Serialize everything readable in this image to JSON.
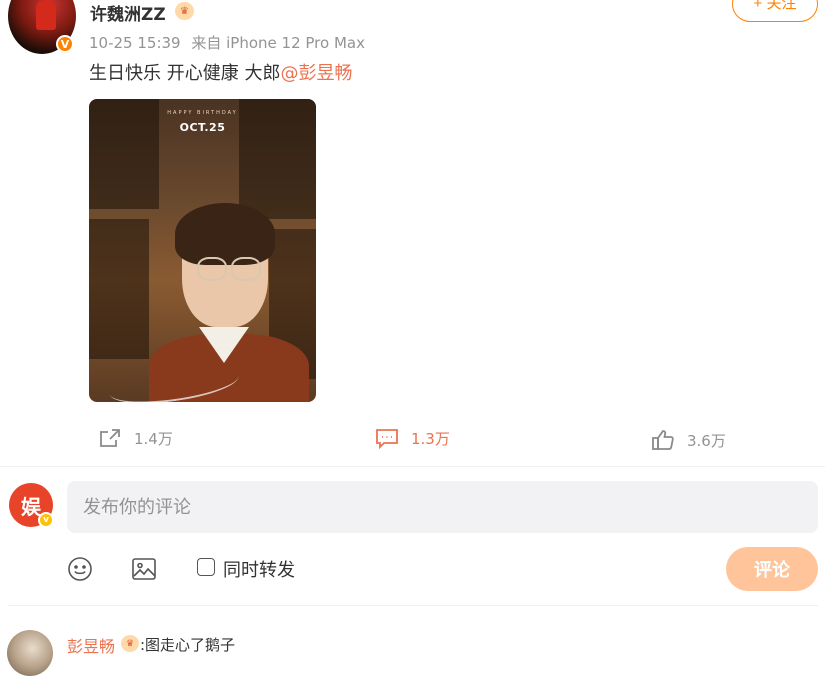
{
  "post": {
    "author": "许魏洲ZZ",
    "verified_badge": "V",
    "time": "10-25 15:39",
    "source": "来自 iPhone 12 Pro Max",
    "follow_label": "+ 关注",
    "text": "生日快乐 开心健康 大郎",
    "mention": "@彭昱畅",
    "image": {
      "tiny_text": "HAPPY BIRTHDAY",
      "date_text": "OCT.25"
    }
  },
  "actions": {
    "forward_count": "1.4万",
    "comment_count": "1.3万",
    "like_count": "3.6万"
  },
  "composer": {
    "avatar_glyph": "娱",
    "placeholder": "发布你的评论",
    "repost_label": "同时转发",
    "submit_label": "评论"
  },
  "comments": [
    {
      "author": "彭昱畅",
      "text": ":图走心了鹅子"
    }
  ],
  "colors": {
    "accent": "#ff8200",
    "link": "#eb7350",
    "submit_bg": "#ffc49a"
  },
  "icons": [
    "crown-icon",
    "forward-icon",
    "comment-icon",
    "like-icon",
    "emoji-icon",
    "image-icon"
  ]
}
